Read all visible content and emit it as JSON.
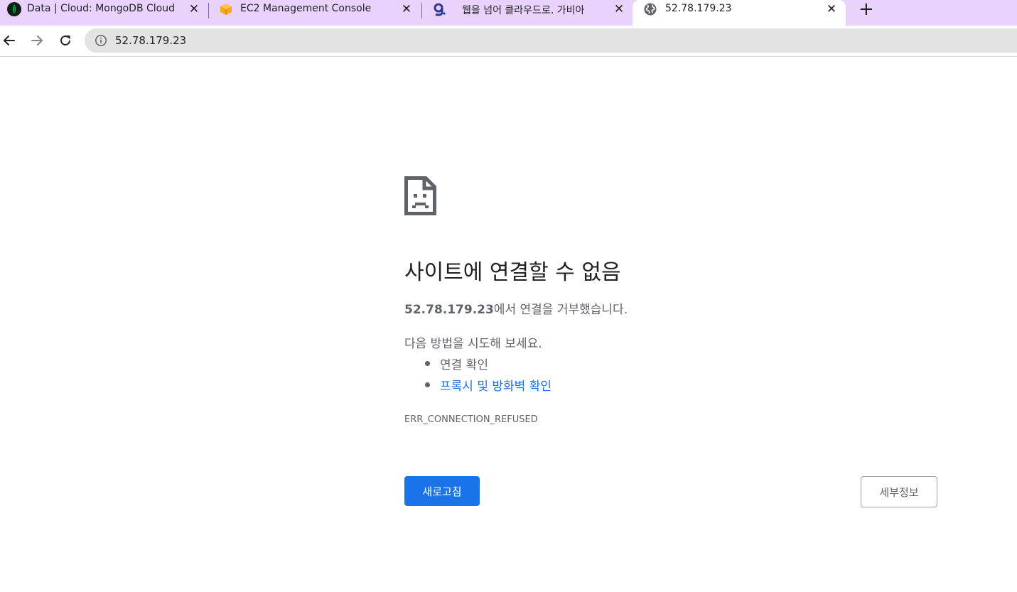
{
  "browser": {
    "tabs": [
      {
        "title": "Data | Cloud: MongoDB Cloud",
        "favicon": "mongodb-leaf-icon",
        "active": false
      },
      {
        "title": "EC2 Management Console",
        "favicon": "aws-box-icon",
        "active": false
      },
      {
        "title": "웹을 넘어 클라우드로. 가비아",
        "favicon": "gabia-g-icon",
        "active": false
      },
      {
        "title": "52.78.179.23",
        "favicon": "globe-icon",
        "active": true
      }
    ],
    "close_glyph": "✕",
    "new_tab_glyph": "+",
    "address_bar": {
      "url": "52.78.179.23",
      "icon": "info-icon"
    },
    "colors": {
      "tabstrip": "#e9d3fd",
      "accent": "#1a73e8"
    }
  },
  "error_page": {
    "icon": "sad-page-icon",
    "title": "사이트에 연결할 수 없음",
    "host": "52.78.179.23",
    "description_suffix": "에서 연결을 거부했습니다.",
    "try_heading": "다음 방법을 시도해 보세요.",
    "suggestions": [
      {
        "text": "연결 확인",
        "link": false
      },
      {
        "text": "프록시 및 방화벽 확인",
        "link": true
      }
    ],
    "error_code": "ERR_CONNECTION_REFUSED",
    "reload_button": "새로고침",
    "details_button": "세부정보"
  }
}
